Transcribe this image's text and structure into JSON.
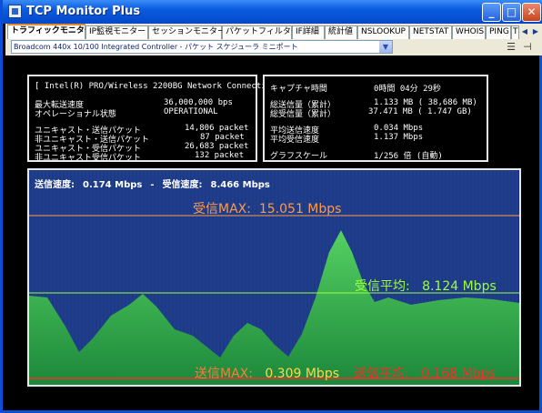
{
  "window": {
    "title": "TCP Monitor Plus",
    "minimize": "_",
    "maximize": "□",
    "close": "✕"
  },
  "tabs": [
    {
      "label": "トラフィックモニター",
      "active": true
    },
    {
      "label": "IP監視モニター"
    },
    {
      "label": "セッションモニター"
    },
    {
      "label": "パケットフィルター"
    },
    {
      "label": "IF詳細"
    },
    {
      "label": "統計値"
    },
    {
      "label": "NSLOOKUP"
    },
    {
      "label": "NETSTAT"
    },
    {
      "label": "WHOIS"
    },
    {
      "label": "PING"
    },
    {
      "label": "T"
    }
  ],
  "tab_nav": {
    "prev": "◀",
    "next": "▶"
  },
  "device_select": {
    "value": "Broadcom 440x 10/100 Integrated Controller - パケット スケジューラ ミニポート",
    "arrow": "▼"
  },
  "toolbar_icons": [
    "list-icon",
    "pin-icon"
  ],
  "left_panel": {
    "connection": "[ Intel(R) PRO/Wireless 2200BG Network Connection ]",
    "rows": [
      {
        "label": "最大転送速度",
        "value": "36,000,000 bps"
      },
      {
        "label": "オペレーショナル状態",
        "value": "OPERATIONAL"
      },
      {
        "label": "ユニキャスト・送信パケット",
        "value": "14,806 packet"
      },
      {
        "label": "非ユニキャスト・送信パケット",
        "value": "87 packet"
      },
      {
        "label": "ユニキャスト・受信パケット",
        "value": "26,683 packet"
      },
      {
        "label": "非ユニキャスト受信パケット",
        "value": "132 packet"
      }
    ]
  },
  "right_panel": {
    "rows": [
      {
        "label": "キャプチャ時間",
        "value": "0時間 04分 29秒"
      },
      {
        "label": "総送信量（累計）",
        "value": "1.133 MB (   38,686 MB)"
      },
      {
        "label": "総受信量（累計）",
        "value": "37.471 MB (   1.747 GB)"
      },
      {
        "label": "平均送信速度",
        "value": "0.034 Mbps"
      },
      {
        "label": "平均受信速度",
        "value": "1.137 Mbps"
      },
      {
        "label": "グラフスケール",
        "value": "1/256 倍 (自動)"
      }
    ]
  },
  "graph": {
    "header": {
      "send_label": "送信速度:",
      "send_value": "0.174 Mbps",
      "dash": "-",
      "recv_label": "受信速度:",
      "recv_value": "8.466 Mbps"
    },
    "recv_max": {
      "label": "受信MAX:",
      "value": "15.051 Mbps"
    },
    "recv_avg": {
      "label": "受信平均:",
      "value": "8.124 Mbps"
    },
    "send_max": {
      "label": "送信MAX:",
      "value": "0.309 Mbps"
    },
    "send_avg": {
      "label": "送信平均:",
      "value": "0.168 Mbps"
    }
  },
  "colors": {
    "graph_bg": "#1c2f95",
    "bar_green": "#3fc44f",
    "recv_max_line": "#ff9a48",
    "recv_avg_line": "#9dff3c",
    "send_max": "#ff7a3a",
    "send_avg": "#ff2a2a",
    "send_max_text": "#ffd84a"
  }
}
